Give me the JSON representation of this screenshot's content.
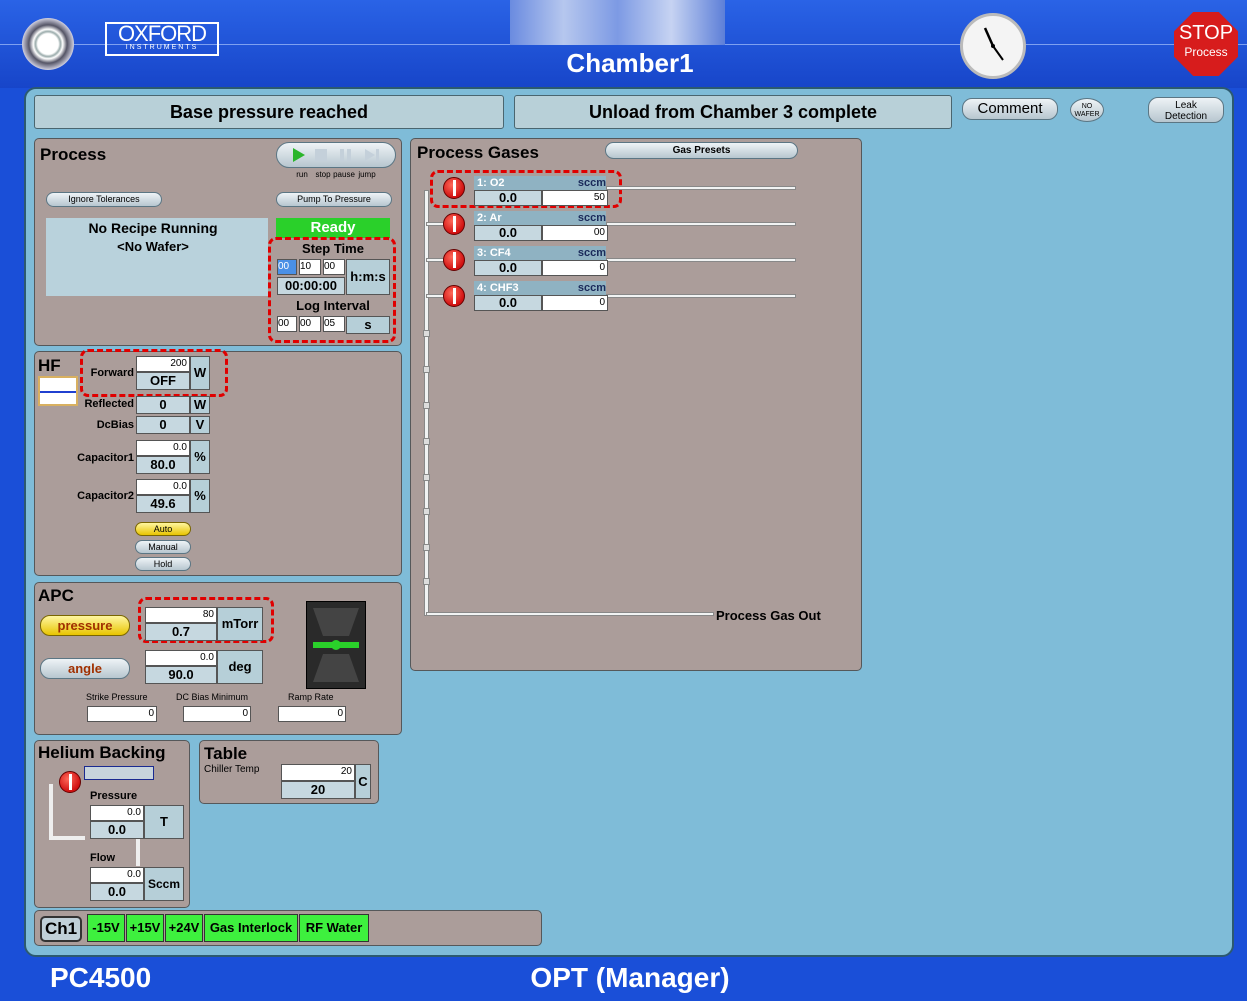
{
  "header": {
    "brand_main": "OXFORD",
    "brand_sub": "INSTRUMENTS",
    "title": "Chamber1",
    "stop_label_1": "STOP",
    "stop_label_2": "Process"
  },
  "status": {
    "left": "Base pressure reached",
    "right": "Unload from Chamber 3 complete",
    "comment": "Comment",
    "no_wafer_1": "NO",
    "no_wafer_2": "WAFER",
    "leak_1": "Leak",
    "leak_2": "Detection"
  },
  "process": {
    "title": "Process",
    "transport": [
      "run",
      "stop",
      "pause",
      "jump"
    ],
    "ignore": "Ignore Tolerances",
    "pump": "Pump To Pressure",
    "recipe": "No Recipe Running",
    "wafer": "<No Wafer>",
    "state": "Ready",
    "step_time": "Step Time",
    "step_h": "00",
    "step_m": "10",
    "step_s": "00",
    "hms": "h:m:s",
    "elapsed": "00:00:00",
    "log_interval": "Log Interval",
    "log_h": "00",
    "log_m": "00",
    "log_s": "05",
    "s_unit": "s"
  },
  "hf": {
    "title": "HF",
    "forward": "Forward",
    "forward_set": "200",
    "forward_val": "OFF",
    "w1": "W",
    "reflected": "Reflected",
    "reflected_val": "0",
    "w2": "W",
    "dcbias": "DcBias",
    "dcbias_val": "0",
    "v": "V",
    "cap1": "Capacitor1",
    "cap1_set": "0.0",
    "cap1_val": "80.0",
    "pct1": "%",
    "cap2": "Capacitor2",
    "cap2_set": "0.0",
    "cap2_val": "49.6",
    "pct2": "%",
    "auto": "Auto",
    "manual": "Manual",
    "hold": "Hold"
  },
  "apc": {
    "title": "APC",
    "pressure": "pressure",
    "angle": "angle",
    "p_set": "80",
    "p_val": "0.7",
    "p_unit": "mTorr",
    "a_set": "0.0",
    "a_val": "90.0",
    "a_unit": "deg",
    "strike": "Strike Pressure",
    "strike_val": "0",
    "dcmin": "DC Bias Minimum",
    "dcmin_val": "0",
    "ramp": "Ramp Rate",
    "ramp_val": "0"
  },
  "helium": {
    "title": "Helium Backing",
    "pressure": "Pressure",
    "p_set": "0.0",
    "p_val": "0.0",
    "p_unit": "T",
    "flow": "Flow",
    "f_set": "0.0",
    "f_val": "0.0",
    "f_unit": "Sccm"
  },
  "table": {
    "title": "Table",
    "chiller": "Chiller Temp",
    "set": "20",
    "val": "20",
    "unit": "C"
  },
  "interlocks": {
    "ch": "Ch1",
    "items": [
      "-15V",
      "+15V",
      "+24V",
      "Gas Interlock",
      "RF Water"
    ]
  },
  "gases": {
    "title": "Process Gases",
    "presets": "Gas Presets",
    "out": "Process Gas Out",
    "lines": [
      {
        "name": "1:  O2",
        "unit": "sccm",
        "val": "0.0",
        "set": "50"
      },
      {
        "name": "2:  Ar",
        "unit": "sccm",
        "val": "0.0",
        "set": "00"
      },
      {
        "name": "3:  CF4",
        "unit": "sccm",
        "val": "0.0",
        "set": "0"
      },
      {
        "name": "4:  CHF3",
        "unit": "sccm",
        "val": "0.0",
        "set": "0"
      }
    ]
  },
  "footer": {
    "left": "PC4500",
    "center": "OPT (Manager)"
  }
}
